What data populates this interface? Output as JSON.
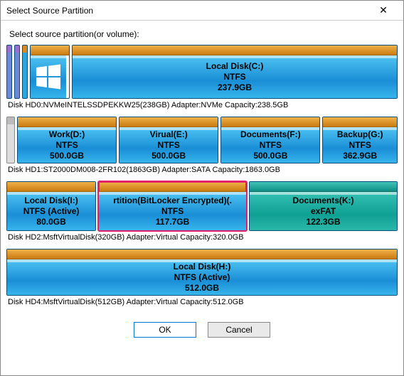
{
  "window": {
    "title": "Select Source Partition",
    "close_glyph": "✕"
  },
  "prompt": "Select source partition(or volume):",
  "disks": [
    {
      "info": "Disk HD0:NVMeINTELSSDPEKKW25(238GB)  Adapter:NVMe  Capacity:238.5GB",
      "main_label": "Local Disk(C:)",
      "main_fs": "NTFS",
      "main_size": "237.9GB"
    },
    {
      "info": "Disk HD1:ST2000DM008-2FR102(1863GB)  Adapter:SATA  Capacity:1863.0GB",
      "p0_label": "Work(D:)",
      "p0_fs": "NTFS",
      "p0_size": "500.0GB",
      "p1_label": "Virual(E:)",
      "p1_fs": "NTFS",
      "p1_size": "500.0GB",
      "p2_label": "Documents(F:)",
      "p2_fs": "NTFS",
      "p2_size": "500.0GB",
      "p3_label": "Backup(G:)",
      "p3_fs": "NTFS",
      "p3_size": "362.9GB"
    },
    {
      "info": "Disk HD2:MsftVirtualDisk(320GB)  Adapter:Virtual  Capacity:320.0GB",
      "p0_label": "Local Disk(I:)",
      "p0_fs": "NTFS (Active)",
      "p0_size": "80.0GB",
      "p1_label": "rtition(BitLocker Encrypted)(.",
      "p1_fs": "NTFS",
      "p1_size": "117.7GB",
      "p2_label": "Documents(K:)",
      "p2_fs": "exFAT",
      "p2_size": "122.3GB"
    },
    {
      "info": "Disk HD4:MsftVirtualDisk(512GB)  Adapter:Virtual  Capacity:512.0GB",
      "p0_label": "Local Disk(H:)",
      "p0_fs": "NTFS (Active)",
      "p0_size": "512.0GB"
    }
  ],
  "buttons": {
    "ok": "OK",
    "cancel": "Cancel"
  }
}
